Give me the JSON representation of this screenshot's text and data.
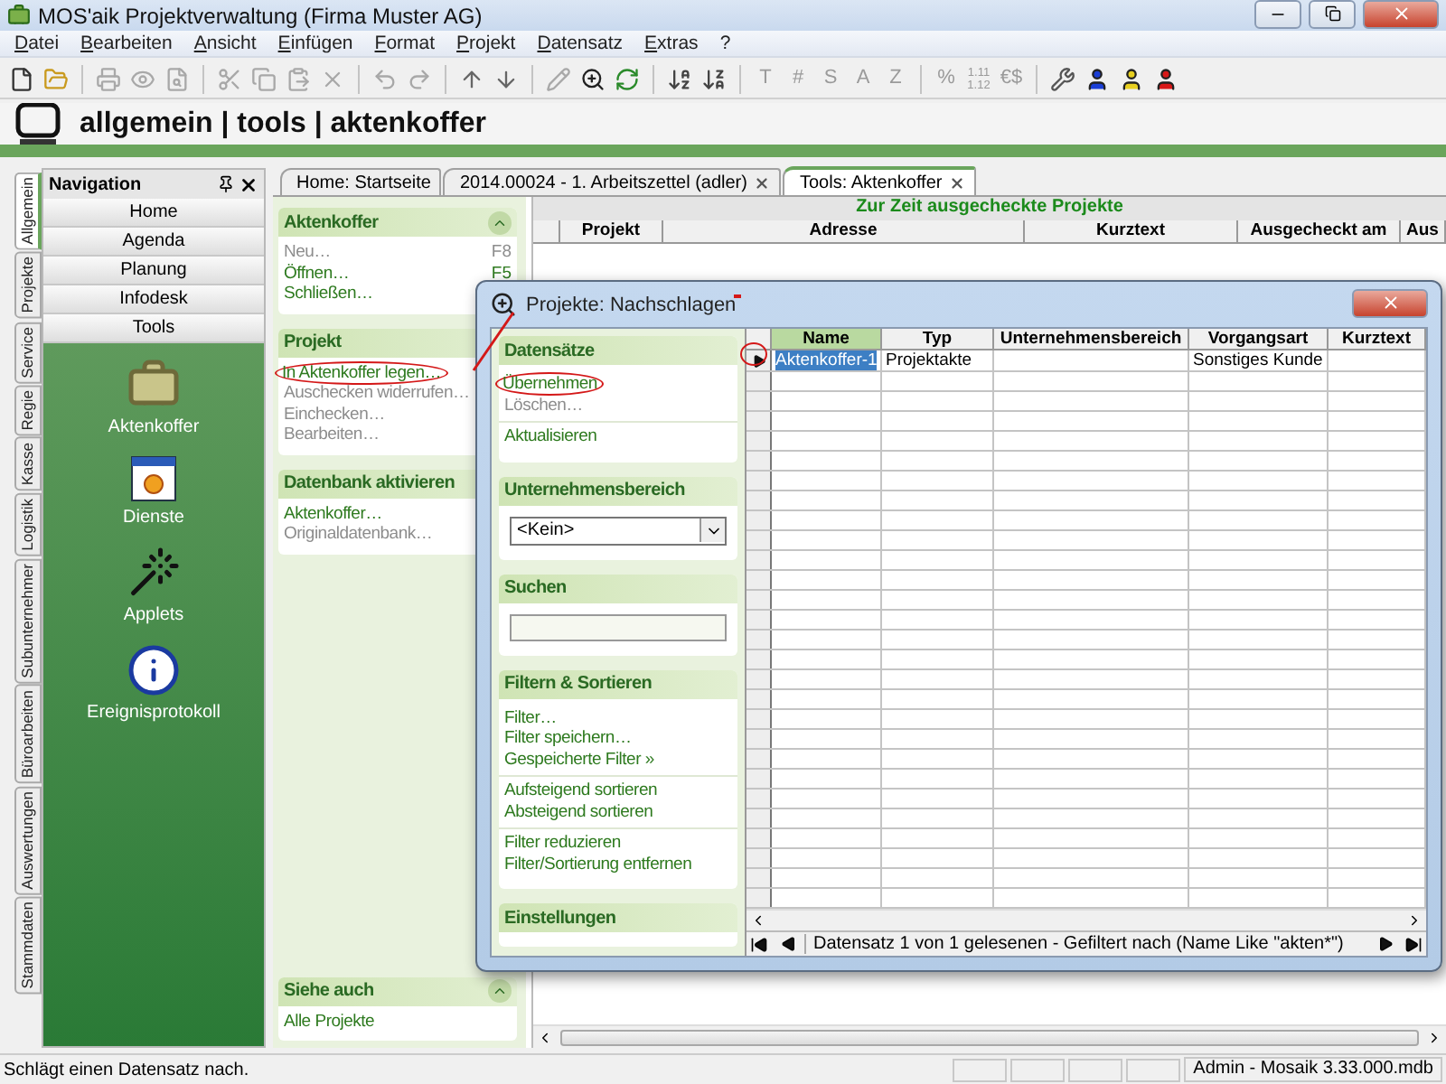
{
  "window": {
    "title": "MOS'aik Projektverwaltung (Firma Muster AG)"
  },
  "menu": [
    "Datei",
    "Bearbeiten",
    "Ansicht",
    "Einfügen",
    "Format",
    "Projekt",
    "Datensatz",
    "Extras",
    "?"
  ],
  "toolbar": [
    [
      {
        "kind": "icon",
        "disabled": false
      },
      {
        "kind": "icon",
        "disabled": false
      }
    ],
    [
      {
        "kind": "icon",
        "disabled": true
      },
      {
        "kind": "icon",
        "disabled": true
      },
      {
        "kind": "icon",
        "disabled": true
      }
    ],
    [
      {
        "kind": "icon",
        "disabled": true
      },
      {
        "kind": "icon",
        "disabled": true
      },
      {
        "kind": "icon",
        "disabled": true
      },
      {
        "kind": "icon",
        "disabled": true
      }
    ],
    [
      {
        "kind": "icon",
        "disabled": true
      },
      {
        "kind": "icon",
        "disabled": true
      }
    ],
    [
      {
        "kind": "icon",
        "disabled": false
      },
      {
        "kind": "icon",
        "disabled": false
      }
    ],
    [
      {
        "kind": "icon",
        "disabled": true
      },
      {
        "kind": "icon",
        "disabled": false
      },
      {
        "kind": "icon",
        "disabled": false
      }
    ],
    [
      {
        "kind": "icon",
        "disabled": false
      },
      {
        "kind": "icon",
        "disabled": false
      }
    ],
    [
      {
        "kind": "glyph",
        "text": "T",
        "disabled": true
      },
      {
        "kind": "glyph",
        "text": "#",
        "disabled": true
      },
      {
        "kind": "glyph",
        "text": "S",
        "disabled": true
      },
      {
        "kind": "glyph",
        "text": "A",
        "disabled": true
      },
      {
        "kind": "glyph",
        "text": "Z",
        "disabled": true
      }
    ],
    [
      {
        "kind": "glyph",
        "text": "%",
        "disabled": true
      },
      {
        "kind": "stacked",
        "lines": [
          "1.11",
          "1.12"
        ],
        "disabled": true
      },
      {
        "kind": "glyph",
        "text": "€$",
        "disabled": true
      }
    ],
    [
      {
        "kind": "icon",
        "disabled": false
      },
      {
        "kind": "person",
        "color": "#1b3fd6"
      },
      {
        "kind": "person",
        "color": "#e8d020"
      },
      {
        "kind": "person",
        "color": "#d81818"
      }
    ]
  ],
  "breadcrumb": "allgemein | tools | aktenkoffer",
  "side_tabs": [
    {
      "label": "Allgemein",
      "selected": true
    },
    {
      "label": "Projekte",
      "selected": false
    },
    {
      "label": "Service",
      "selected": false
    },
    {
      "label": "Regie",
      "selected": false
    },
    {
      "label": "Kasse",
      "selected": false
    },
    {
      "label": "Logistik",
      "selected": false
    },
    {
      "label": "Subunternehmer",
      "selected": false
    },
    {
      "label": "Büroarbeiten",
      "selected": false
    },
    {
      "label": "Auswertungen",
      "selected": false
    },
    {
      "label": "Stammdaten",
      "selected": false
    }
  ],
  "navigation": {
    "title": "Navigation",
    "buttons": [
      "Home",
      "Agenda",
      "Planung",
      "Infodesk",
      "Tools"
    ],
    "tools": [
      "Aktenkoffer",
      "Dienste",
      "Applets",
      "Ereignisprotokoll"
    ]
  },
  "doc_tabs": [
    {
      "label": "Home: Startseite",
      "closable": false,
      "selected": false
    },
    {
      "label": "2014.00024 - 1. Arbeitszettel (adler)",
      "closable": true,
      "selected": false
    },
    {
      "label": "Tools: Aktenkoffer",
      "closable": true,
      "selected": true
    }
  ],
  "tasks": [
    {
      "title": "Aktenkoffer",
      "collapse_button": true,
      "items": [
        {
          "label": "Neu…",
          "shortcut": "F8",
          "disabled": true,
          "circled": false
        },
        {
          "label": "Öffnen…",
          "shortcut": "F5",
          "disabled": false,
          "circled": false
        },
        {
          "label": "Schließen…",
          "disabled": false,
          "circled": false
        }
      ]
    },
    {
      "title": "Projekt",
      "collapse_button": false,
      "items": [
        {
          "label": "In Aktenkoffer legen…",
          "disabled": false,
          "circled": true
        },
        {
          "label": "Auschecken widerrufen…",
          "disabled": true,
          "circled": false
        },
        {
          "label": "Einchecken…",
          "disabled": true,
          "circled": false
        },
        {
          "label": "Bearbeiten…",
          "disabled": true,
          "circled": false
        }
      ]
    },
    {
      "title": "Datenbank aktivieren",
      "collapse_button": false,
      "items": [
        {
          "label": "Aktenkoffer…",
          "disabled": false,
          "circled": false
        },
        {
          "label": "Originaldatenbank…",
          "disabled": true,
          "circled": false
        }
      ]
    }
  ],
  "see_also": {
    "title": "Siehe auch",
    "collapse_button": true,
    "items": [
      {
        "label": "Alle Projekte",
        "disabled": false,
        "circled": false
      }
    ]
  },
  "checked_out": {
    "title": "Zur Zeit ausgecheckte Projekte",
    "columns": [
      "Projekt",
      "Adresse",
      "Kurztext",
      "Ausgecheckt am",
      "Aus"
    ]
  },
  "dialog": {
    "title": "Projekte: Nachschlagen",
    "sections": [
      {
        "kind": "links",
        "title": "Datensätze",
        "blocks": [
          [
            {
              "label": "Übernehmen",
              "disabled": false,
              "circled": true
            },
            {
              "label": "Löschen…",
              "disabled": true,
              "circled": false
            }
          ],
          [
            {
              "label": "Aktualisieren",
              "disabled": false,
              "circled": false
            }
          ]
        ]
      },
      {
        "kind": "select",
        "title": "Unternehmensbereich",
        "value": "<Kein>"
      },
      {
        "kind": "search",
        "title": "Suchen"
      },
      {
        "kind": "links",
        "title": "Filtern & Sortieren",
        "blocks": [
          [
            {
              "label": "Filter…",
              "disabled": false,
              "circled": false
            },
            {
              "label": "Filter speichern…",
              "disabled": false,
              "circled": false
            },
            {
              "label": "Gespeicherte Filter »",
              "disabled": false,
              "circled": false
            }
          ],
          [
            {
              "label": "Aufsteigend sortieren",
              "disabled": false,
              "circled": false
            },
            {
              "label": "Absteigend sortieren",
              "disabled": false,
              "circled": false
            }
          ],
          [
            {
              "label": "Filter reduzieren",
              "disabled": false,
              "circled": false
            },
            {
              "label": "Filter/Sortierung entfernen",
              "disabled": false,
              "circled": false
            }
          ]
        ]
      },
      {
        "kind": "links",
        "title": "Einstellungen"
      }
    ],
    "columns": [
      {
        "label": "Name",
        "current": true
      },
      {
        "label": "Typ",
        "current": false
      },
      {
        "label": "Unternehmensbereich",
        "current": false
      },
      {
        "label": "Vorgangsart",
        "current": false
      },
      {
        "label": "Kurztext",
        "current": false
      }
    ],
    "rows": [
      {
        "cells": [
          "Aktenkoffer-1",
          "Projektakte",
          "",
          "Sonstiges Kunde",
          ""
        ],
        "selected": true
      }
    ],
    "record_info": "Datensatz 1 von 1 gelesenen - Gefiltert nach (Name Like \"akten*\")"
  },
  "status_bar": {
    "message": "Schlägt einen Datensatz nach.",
    "database": "Admin - Mosaik 3.33.000.mdb"
  }
}
